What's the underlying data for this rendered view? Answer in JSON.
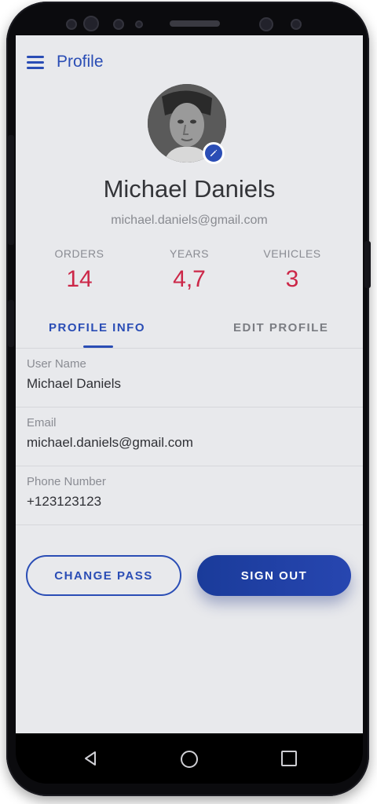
{
  "header": {
    "title": "Profile",
    "menu_icon": "hamburger-menu-icon"
  },
  "profile": {
    "name": "Michael Daniels",
    "email": "michael.daniels@gmail.com",
    "avatar_icon": "user-photo",
    "edit_icon": "pencil-icon"
  },
  "stats": [
    {
      "label": "ORDERS",
      "value": "14"
    },
    {
      "label": "YEARS",
      "value": "4,7"
    },
    {
      "label": "VEHICLES",
      "value": "3"
    }
  ],
  "tabs": [
    {
      "label": "PROFILE INFO",
      "active": true
    },
    {
      "label": "EDIT PROFILE",
      "active": false
    }
  ],
  "fields": [
    {
      "label": "User Name",
      "value": "Michael Daniels"
    },
    {
      "label": "Email",
      "value": "michael.daniels@gmail.com"
    },
    {
      "label": "Phone Number",
      "value": "+123123123"
    }
  ],
  "buttons": {
    "change_pass": "CHANGE PASS",
    "sign_out": "SIGN OUT"
  },
  "navbar": {
    "back_icon": "back-triangle-icon",
    "home_icon": "home-circle-icon",
    "recent_icon": "recent-apps-icon"
  },
  "colors": {
    "accent": "#2a4db5",
    "stat_value": "#cc2748",
    "background": "#e8e9ec"
  }
}
